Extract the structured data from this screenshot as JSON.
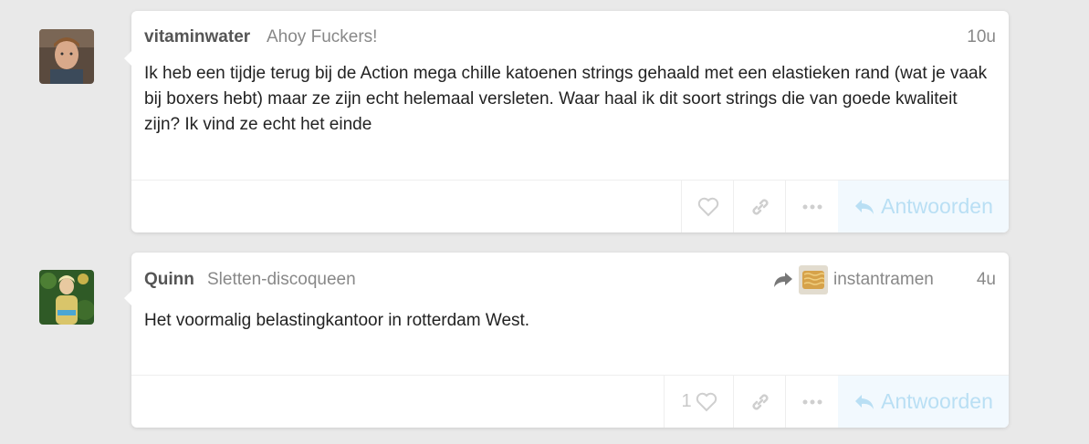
{
  "posts": [
    {
      "username": "vitaminwater",
      "user_title": "Ahoy Fuckers!",
      "age": "10u",
      "body": "Ik heb een tijdje terug bij de Action mega chille katoenen strings gehaald met een elastieken rand (wat je vaak bij boxers hebt) maar ze zijn echt helemaal versleten. Waar haal ik dit soort strings die van goede kwaliteit zijn? Ik vind ze echt het einde",
      "reply_label": "Antwoorden",
      "like_count": ""
    },
    {
      "username": "Quinn",
      "user_title": "Sletten-discoqueen",
      "age": "4u",
      "reply_to_user": "instantramen",
      "body": "Het voormalig belastingkantoor in rotterdam West.",
      "reply_label": "Antwoorden",
      "like_count": "1"
    }
  ],
  "icons": {
    "like": "heart-icon",
    "link": "link-icon",
    "more": "ellipsis-icon",
    "reply": "reply-arrow-icon",
    "reply_to": "share-arrow-icon"
  },
  "colors": {
    "background": "#e9e9e9",
    "card": "#ffffff",
    "reply_bg": "#f2f9fe",
    "reply_text": "#b9dff4",
    "muted": "#888888"
  }
}
